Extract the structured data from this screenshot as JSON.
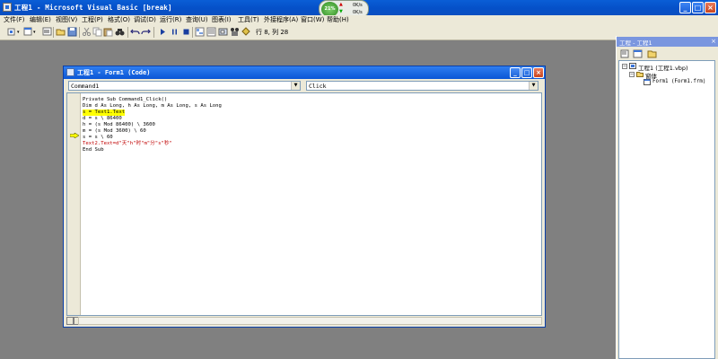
{
  "app": {
    "title": "工程1 - Microsoft Visual Basic [break]"
  },
  "netmeter": {
    "percent": "21%",
    "up_rate": "0K/s",
    "down_rate": "0K/s"
  },
  "menu": {
    "items": [
      "文件(F)",
      "编辑(E)",
      "视图(V)",
      "工程(P)",
      "格式(O)",
      "调试(D)",
      "运行(R)",
      "查询(U)",
      "图表(I)",
      "工具(T)",
      "外接程序(A)",
      "窗口(W)",
      "帮助(H)"
    ]
  },
  "toolbar": {
    "position_text": "行 8, 列 28"
  },
  "code_window": {
    "title": "工程1 - Form1 (Code)",
    "object_combo": "Command1",
    "procedure_combo": "Click",
    "lines": [
      "Private Sub Command1_Click()",
      "Dim d As Long, h As Long, m As Long, s As Long",
      "s = Text1.Text",
      "d = s \\ 86400",
      "h = (s Mod 86400) \\ 3600",
      "m = (s Mod 3600) \\ 60",
      "s = s \\ 60",
      "Text2.Text=d\"天\"h\"时\"m\"分\"s\"秒\"",
      "End Sub"
    ]
  },
  "project_explorer": {
    "title": "工程 - 工程1",
    "tree": {
      "project": "工程1 (工程1.vbp)",
      "folder": "窗体",
      "form": "Form1 (Form1.frm)"
    }
  },
  "colors": {
    "titlebar": "#0550c8",
    "desktop": "#808080",
    "highlight": "#ffff00",
    "string_red": "#c00000"
  }
}
